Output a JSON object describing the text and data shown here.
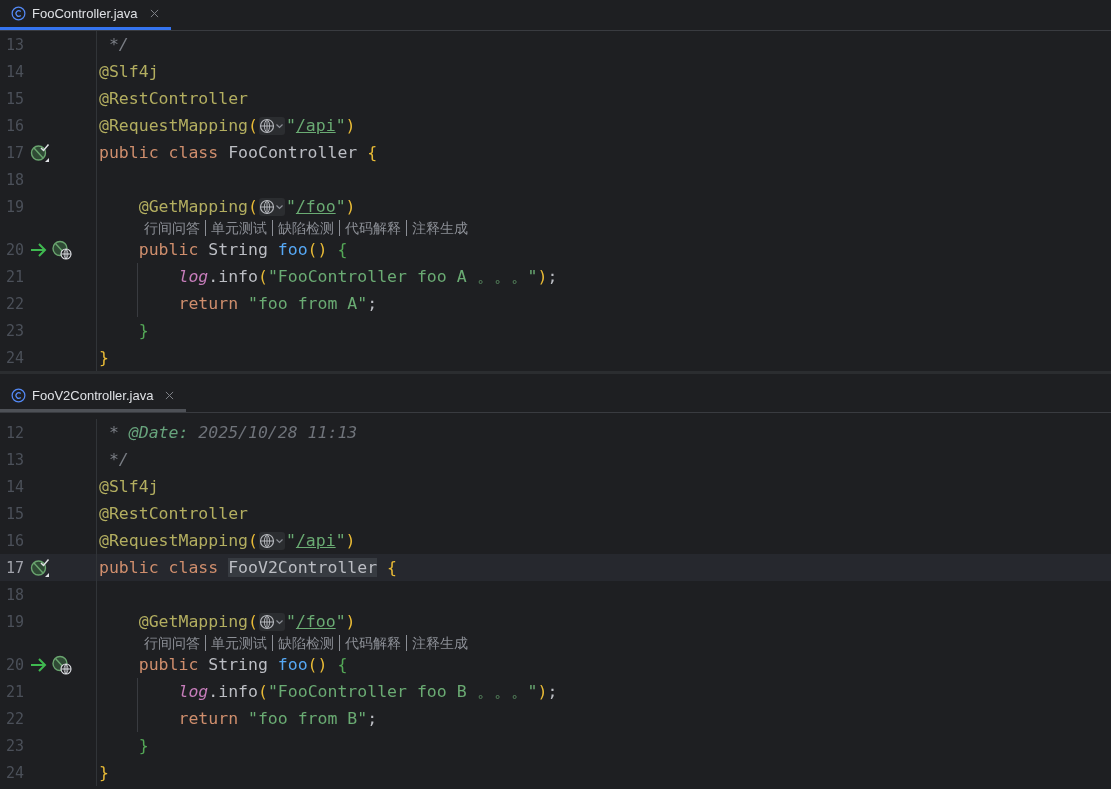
{
  "panes": [
    {
      "tab": {
        "label": "FooController.java",
        "selected": true
      },
      "lines": [
        {
          "kind": "code",
          "number": "13",
          "current": false,
          "tokens": [
            {
              "kind": "comment",
              "text": " */"
            }
          ]
        },
        {
          "kind": "code",
          "number": "14",
          "current": false,
          "tokens": [
            {
              "kind": "annotation",
              "text": "@Slf4j"
            }
          ]
        },
        {
          "kind": "code",
          "number": "15",
          "current": false,
          "tokens": [
            {
              "kind": "annotation",
              "text": "@RestController"
            }
          ]
        },
        {
          "kind": "code",
          "number": "16",
          "current": false,
          "tokens": [
            {
              "kind": "annotation",
              "text": "@RequestMapping"
            },
            {
              "kind": "paren",
              "text": "("
            },
            {
              "kind": "globe"
            },
            {
              "kind": "string",
              "text": "\""
            },
            {
              "kind": "url",
              "text": "/api"
            },
            {
              "kind": "string",
              "text": "\""
            },
            {
              "kind": "paren",
              "text": ")"
            }
          ]
        },
        {
          "kind": "code",
          "number": "17",
          "current": false,
          "gutter": [
            {
              "kind": "bean"
            }
          ],
          "tokens": [
            {
              "kind": "keyword",
              "text": "public class"
            },
            {
              "kind": "plain",
              "text": "FooController",
              "gap": true
            },
            {
              "kind": "paren",
              "text": "{",
              "gap": true
            }
          ]
        },
        {
          "kind": "code",
          "number": "18",
          "current": false
        },
        {
          "kind": "code",
          "number": "19",
          "current": false,
          "indent": {
            "kind": "method"
          },
          "tokens": [
            {
              "kind": "annotation",
              "text": "@GetMapping"
            },
            {
              "kind": "paren",
              "text": "("
            },
            {
              "kind": "globe"
            },
            {
              "kind": "string",
              "text": "\""
            },
            {
              "kind": "url",
              "text": "/foo"
            },
            {
              "kind": "string",
              "text": "\""
            },
            {
              "kind": "paren",
              "text": ")"
            }
          ]
        },
        {
          "kind": "hints",
          "indent": {
            "kind": "method"
          },
          "items": [
            "行间问答",
            "单元测试",
            "缺陷检测",
            "代码解释",
            "注释生成"
          ]
        },
        {
          "kind": "code",
          "number": "20",
          "current": false,
          "indent": {
            "kind": "method"
          },
          "gutter": [
            {
              "kind": "arrow"
            },
            {
              "kind": "bean-web"
            }
          ],
          "tokens": [
            {
              "kind": "keyword",
              "text": "public"
            },
            {
              "kind": "plain",
              "text": "String",
              "gap": true
            },
            {
              "kind": "function",
              "text": "foo",
              "gap": true
            },
            {
              "kind": "paren",
              "text": "()"
            },
            {
              "kind": "brace",
              "text": "{",
              "gap": true
            }
          ]
        },
        {
          "kind": "code",
          "number": "21",
          "current": false,
          "indent": {
            "kind": "body"
          },
          "tokens": [
            {
              "kind": "field",
              "text": "log"
            },
            {
              "kind": "plain",
              "text": ".info"
            },
            {
              "kind": "paren",
              "text": "("
            },
            {
              "kind": "string",
              "text": "\"FooController foo A 。。。\""
            },
            {
              "kind": "paren",
              "text": ")"
            },
            {
              "kind": "plain",
              "text": ";"
            }
          ]
        },
        {
          "kind": "code",
          "number": "22",
          "current": false,
          "indent": {
            "kind": "body"
          },
          "tokens": [
            {
              "kind": "keyword",
              "text": "return"
            },
            {
              "kind": "string",
              "text": "\"foo from A\"",
              "gap": true
            },
            {
              "kind": "plain",
              "text": ";"
            }
          ]
        },
        {
          "kind": "code",
          "number": "23",
          "current": false,
          "indent": {
            "kind": "method"
          },
          "tokens": [
            {
              "kind": "brace",
              "text": "}"
            }
          ]
        },
        {
          "kind": "code",
          "number": "24",
          "current": false,
          "tokens": [
            {
              "kind": "paren",
              "text": "}"
            }
          ]
        }
      ]
    },
    {
      "tab": {
        "label": "FooV2Controller.java",
        "selected": false
      },
      "lines": [
        {
          "kind": "code",
          "number": "12",
          "current": false,
          "tokens": [
            {
              "kind": "comment",
              "text": " *"
            },
            {
              "kind": "doctag",
              "text": "@Date:",
              "gap": true
            },
            {
              "kind": "doctext",
              "text": "2025/10/28 11:13",
              "gap": true
            }
          ]
        },
        {
          "kind": "code",
          "number": "13",
          "current": false,
          "tokens": [
            {
              "kind": "comment",
              "text": " */"
            }
          ]
        },
        {
          "kind": "code",
          "number": "14",
          "current": false,
          "tokens": [
            {
              "kind": "annotation",
              "text": "@Slf4j"
            }
          ]
        },
        {
          "kind": "code",
          "number": "15",
          "current": false,
          "tokens": [
            {
              "kind": "annotation",
              "text": "@RestController"
            }
          ]
        },
        {
          "kind": "code",
          "number": "16",
          "current": false,
          "tokens": [
            {
              "kind": "annotation",
              "text": "@RequestMapping"
            },
            {
              "kind": "paren",
              "text": "("
            },
            {
              "kind": "globe"
            },
            {
              "kind": "string",
              "text": "\""
            },
            {
              "kind": "url",
              "text": "/api"
            },
            {
              "kind": "string",
              "text": "\""
            },
            {
              "kind": "paren",
              "text": ")"
            }
          ]
        },
        {
          "kind": "code",
          "number": "17",
          "current": true,
          "gutter": [
            {
              "kind": "bean"
            }
          ],
          "tokens": [
            {
              "kind": "keyword",
              "text": "public class"
            },
            {
              "kind": "occurrence",
              "text": "FooV2Controller",
              "gap": true
            },
            {
              "kind": "paren",
              "text": "{",
              "gap": true
            }
          ]
        },
        {
          "kind": "code",
          "number": "18",
          "current": false
        },
        {
          "kind": "code",
          "number": "19",
          "current": false,
          "indent": {
            "kind": "method"
          },
          "tokens": [
            {
              "kind": "annotation",
              "text": "@GetMapping"
            },
            {
              "kind": "paren",
              "text": "("
            },
            {
              "kind": "globe"
            },
            {
              "kind": "string",
              "text": "\""
            },
            {
              "kind": "url",
              "text": "/foo"
            },
            {
              "kind": "string",
              "text": "\""
            },
            {
              "kind": "paren",
              "text": ")"
            }
          ]
        },
        {
          "kind": "hints",
          "indent": {
            "kind": "method"
          },
          "items": [
            "行间问答",
            "单元测试",
            "缺陷检测",
            "代码解释",
            "注释生成"
          ]
        },
        {
          "kind": "code",
          "number": "20",
          "current": false,
          "indent": {
            "kind": "method"
          },
          "gutter": [
            {
              "kind": "arrow"
            },
            {
              "kind": "bean-web"
            }
          ],
          "tokens": [
            {
              "kind": "keyword",
              "text": "public"
            },
            {
              "kind": "plain",
              "text": "String",
              "gap": true
            },
            {
              "kind": "function",
              "text": "foo",
              "gap": true
            },
            {
              "kind": "paren",
              "text": "()"
            },
            {
              "kind": "brace",
              "text": "{",
              "gap": true
            }
          ]
        },
        {
          "kind": "code",
          "number": "21",
          "current": false,
          "indent": {
            "kind": "body"
          },
          "tokens": [
            {
              "kind": "field",
              "text": "log"
            },
            {
              "kind": "plain",
              "text": ".info"
            },
            {
              "kind": "paren",
              "text": "("
            },
            {
              "kind": "string",
              "text": "\"FooController foo B 。。。\""
            },
            {
              "kind": "paren",
              "text": ")"
            },
            {
              "kind": "plain",
              "text": ";"
            }
          ]
        },
        {
          "kind": "code",
          "number": "22",
          "current": false,
          "indent": {
            "kind": "body"
          },
          "tokens": [
            {
              "kind": "keyword",
              "text": "return"
            },
            {
              "kind": "string",
              "text": "\"foo from B\"",
              "gap": true
            },
            {
              "kind": "plain",
              "text": ";"
            }
          ]
        },
        {
          "kind": "code",
          "number": "23",
          "current": false,
          "indent": {
            "kind": "method"
          },
          "tokens": [
            {
              "kind": "brace",
              "text": "}"
            }
          ]
        },
        {
          "kind": "code",
          "number": "24",
          "current": false,
          "tokens": [
            {
              "kind": "paren",
              "text": "}"
            }
          ]
        }
      ]
    }
  ]
}
